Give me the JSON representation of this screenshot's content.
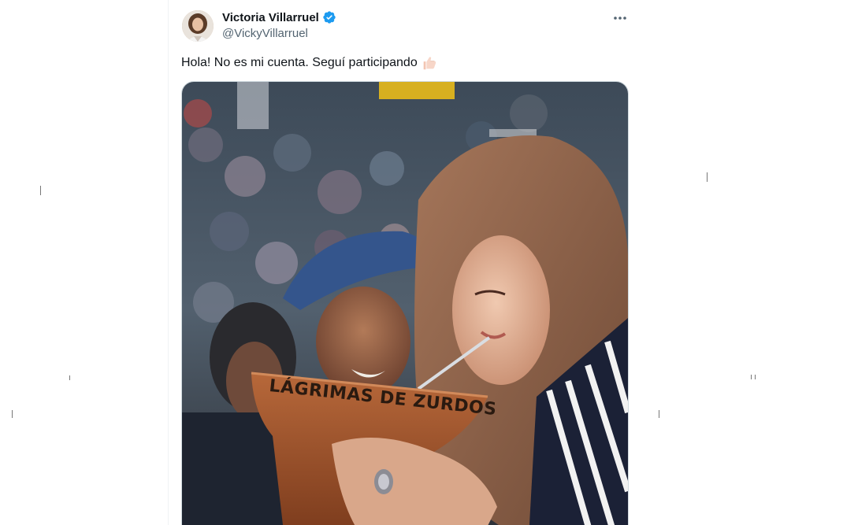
{
  "tweet": {
    "author": {
      "display_name": "Victoria Villarruel",
      "handle": "@VickyVillarruel",
      "verified": true,
      "avatar_icon": "profile-photo"
    },
    "text": "Hola! No es mi cuenta. Seguí participando",
    "emoji": "thumbs-up-icon",
    "media": {
      "overlay_text": "LÁGRIMAS DE ZURDOS"
    }
  },
  "colors": {
    "verified": "#1d9bf0",
    "text_primary": "#0f1419",
    "text_secondary": "#536471",
    "border": "#cfd9de"
  }
}
